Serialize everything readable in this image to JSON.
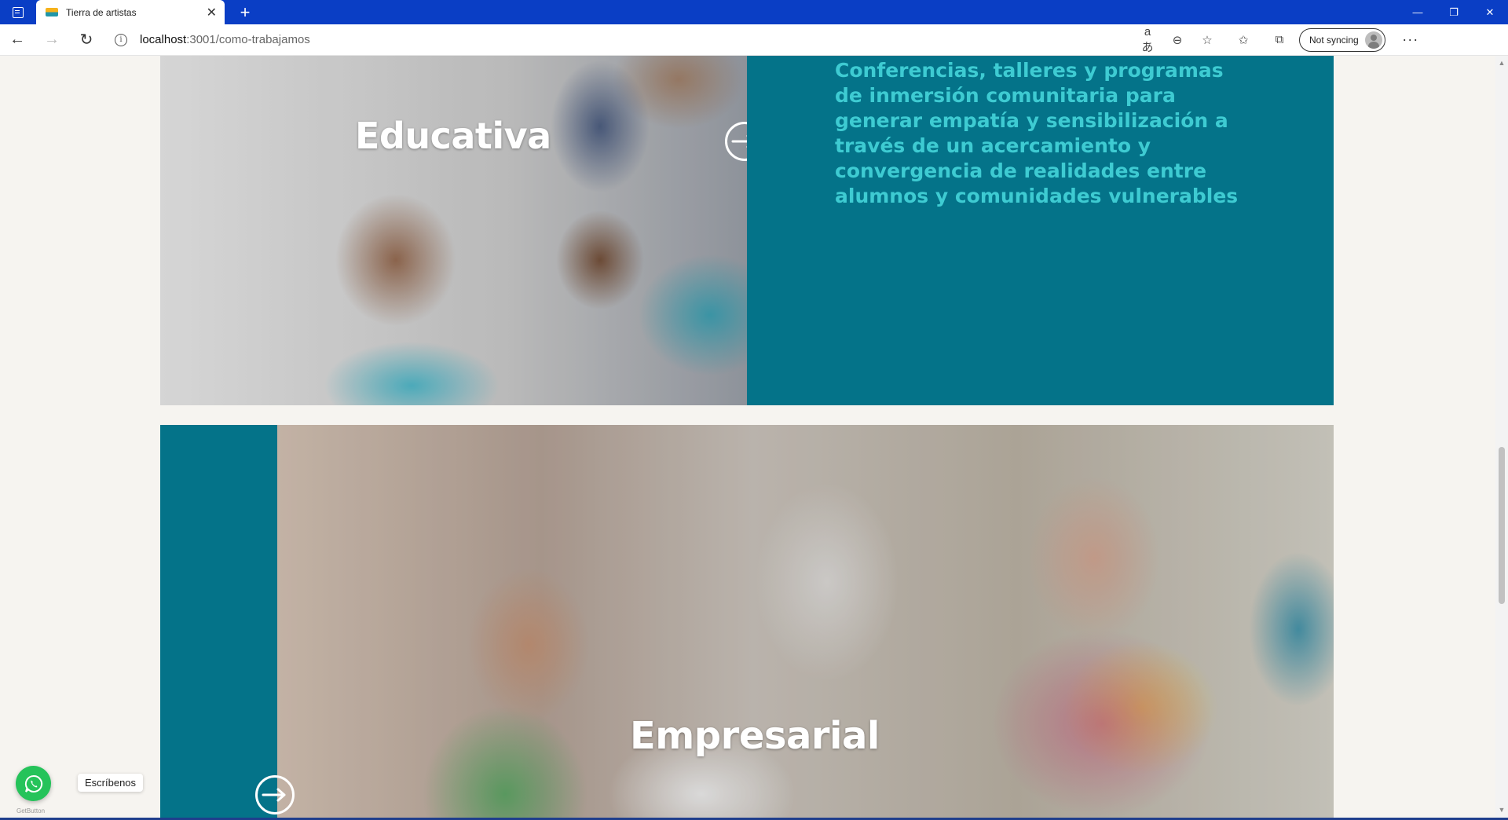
{
  "browser": {
    "tab_title": "Tierra de artistas",
    "url_host": "localhost",
    "url_path": ":3001/como-trabajamos",
    "sync_label": "Not syncing"
  },
  "cards": [
    {
      "title": "Educativa",
      "description": "Conferencias, talleres y programas de inmersión comunitaria para generar empatía y sensibilización a través de un acercamiento y convergencia de realidades entre alumnos y comunidades vulnerables"
    },
    {
      "title": "Empresarial"
    }
  ],
  "whatsapp": {
    "label": "Escríbenos",
    "brand": "GetButton"
  },
  "colors": {
    "teal_panel": "#047389",
    "text_highlight": "#3ecbd2",
    "tabbar": "#0a3ec5",
    "whatsapp": "#25c35a"
  },
  "icons": {
    "card_arrow": "arrow-right-circle-icon",
    "whatsapp": "whatsapp-icon"
  }
}
